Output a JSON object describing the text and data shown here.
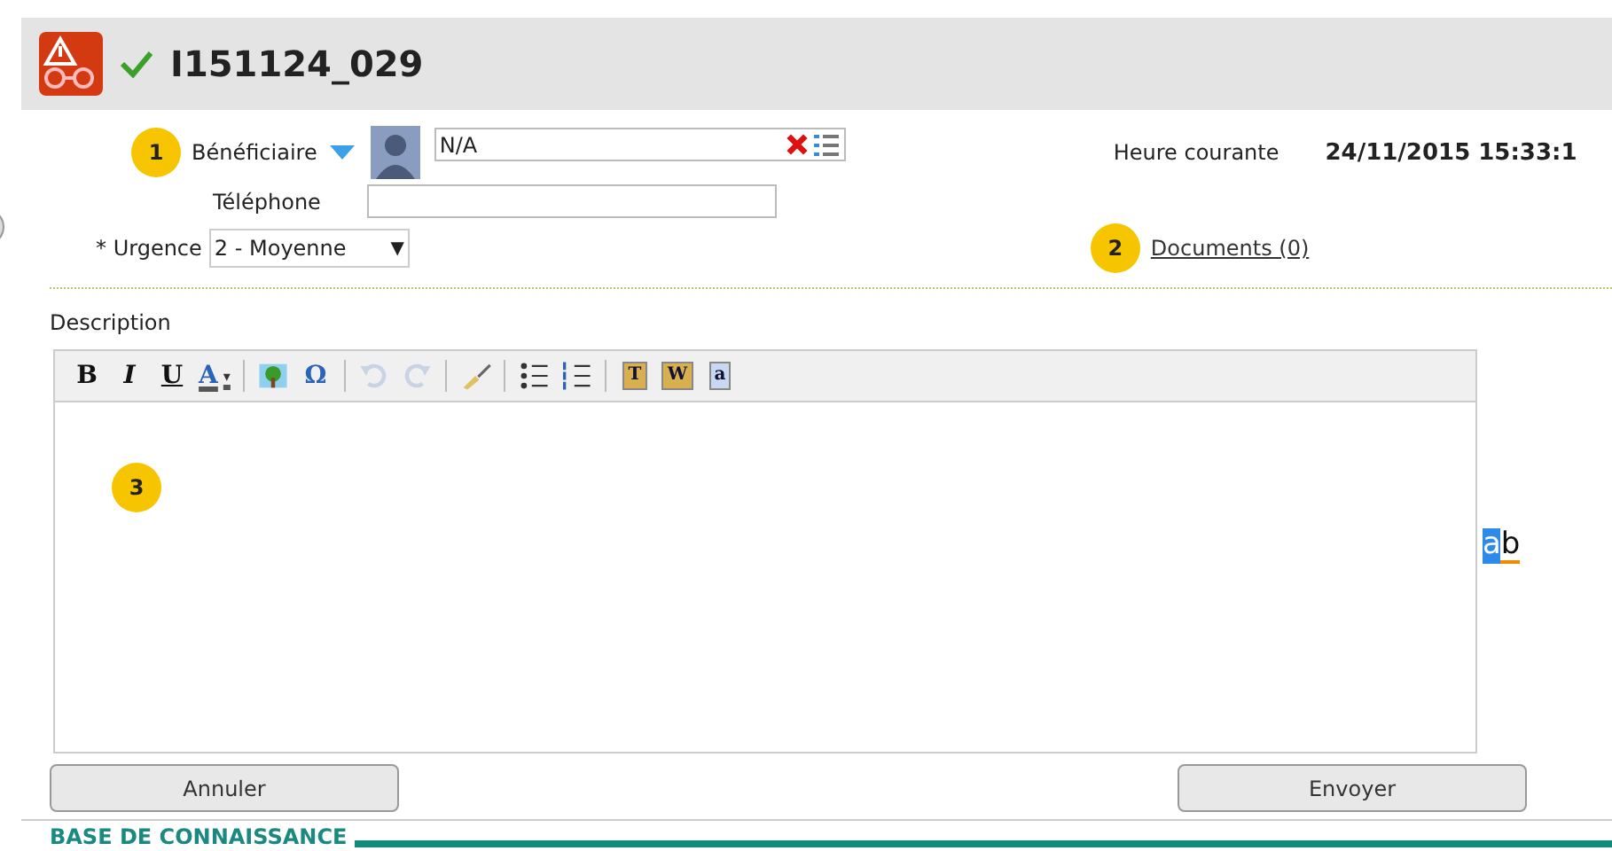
{
  "header": {
    "title": "I151124_029",
    "validated": true
  },
  "form": {
    "beneficiary": {
      "badge": "1",
      "label": "Bénéficiaire",
      "value": "N/A"
    },
    "phone": {
      "label": "Téléphone"
    },
    "urgency": {
      "label": "* Urgence",
      "value": "2 - Moyenne",
      "arrow": "▼"
    },
    "clock": {
      "label": "Heure courante",
      "value": "24/11/2015 15:33:1"
    },
    "documents": {
      "badge": "2",
      "label": "Documents (0)"
    }
  },
  "description": {
    "label": "Description",
    "badge": "3",
    "toolbar": [
      [
        {
          "kind": "bold",
          "label": "B",
          "disabled": false
        },
        {
          "kind": "italic",
          "label": "I",
          "disabled": false
        },
        {
          "kind": "underline",
          "label": "U",
          "disabled": false
        },
        {
          "kind": "color",
          "label": "A",
          "arrow": "▾",
          "disabled": false
        }
      ],
      [
        {
          "kind": "image",
          "disabled": false
        },
        {
          "kind": "symbol",
          "label": "Ω",
          "disabled": false
        }
      ],
      [
        {
          "kind": "undo",
          "disabled": true
        },
        {
          "kind": "redo",
          "disabled": true
        }
      ],
      [
        {
          "kind": "brush",
          "disabled": false
        }
      ],
      [
        {
          "kind": "bullets",
          "disabled": false
        },
        {
          "kind": "numbers",
          "disabled": false
        }
      ],
      [
        {
          "kind": "paste-text",
          "label": "T",
          "disabled": false
        },
        {
          "kind": "paste-word",
          "label": "W",
          "disabled": false
        },
        {
          "kind": "select-all",
          "label": "a",
          "disabled": false
        }
      ]
    ],
    "spell": {
      "first": "a",
      "second": "b"
    }
  },
  "buttons": [
    "Annuler",
    "Envoyer"
  ],
  "section": {
    "title": "BASE DE CONNAISSANCE"
  }
}
